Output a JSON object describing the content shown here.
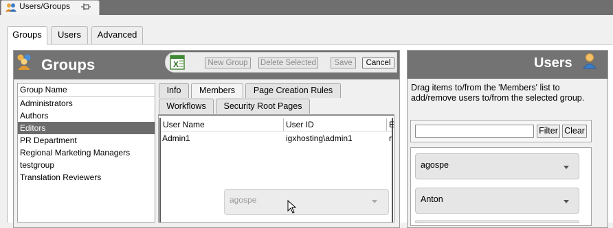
{
  "window": {
    "title": "Users/Groups"
  },
  "top_tabs": [
    "Groups",
    "Users",
    "Advanced"
  ],
  "groups_panel": {
    "title": "Groups",
    "toolbar": {
      "new_group": "New Group",
      "delete_selected": "Delete Selected",
      "save": "Save",
      "cancel": "Cancel"
    },
    "list_header": "Group Name",
    "items": [
      "Administrators",
      "Authors",
      "Editors",
      "PR Department",
      "Regional Marketing Managers",
      "testgroup",
      "Translation Reviewers"
    ],
    "selected": "Editors"
  },
  "detail_tabs": {
    "row1": [
      "Info",
      "Members",
      "Page Creation Rules"
    ],
    "row2": [
      "Workflows",
      "Security Root Pages"
    ],
    "active": "Members"
  },
  "members": {
    "columns": [
      "User Name",
      "User ID",
      "E"
    ],
    "rows": [
      {
        "user_name": "Admin1",
        "user_id": "igxhosting\\admin1",
        "extra": "r"
      }
    ]
  },
  "drag_ghost": {
    "label": "agospe"
  },
  "users_panel": {
    "title": "Users",
    "description": "Drag items to/from the 'Members' list to add/remove users to/from the selected group.",
    "filter": {
      "value": "",
      "filter_label": "Filter",
      "clear_label": "Clear"
    },
    "items": [
      "agospe",
      "Anton"
    ]
  },
  "colors": {
    "header_bg": "#737373",
    "selected_bg": "#6c6c6c",
    "accent": "#3a7dc9"
  }
}
